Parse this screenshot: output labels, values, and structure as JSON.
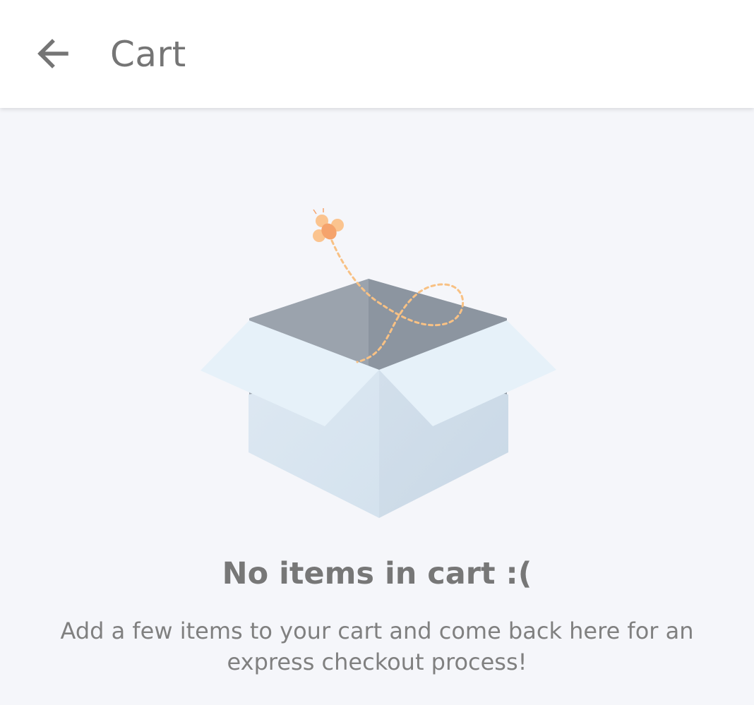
{
  "app_bar": {
    "title": "Cart",
    "back_icon": "arrow-left-icon"
  },
  "empty_state": {
    "illustration": "open-box-with-bee-illustration",
    "heading": "No items in cart :(",
    "message": "Add a few items to your cart and come back here for an express checkout process!"
  },
  "colors": {
    "app_bar_bg": "#ffffff",
    "page_bg": "#f5f6fa",
    "title_text": "#757575",
    "body_text": "#808080",
    "box_light": "#e8f1f8",
    "box_side": "#d4e1ed",
    "box_inside": "#959ea8",
    "bee_orange": "#f5a36c",
    "bee_wing": "#fbc48f"
  }
}
